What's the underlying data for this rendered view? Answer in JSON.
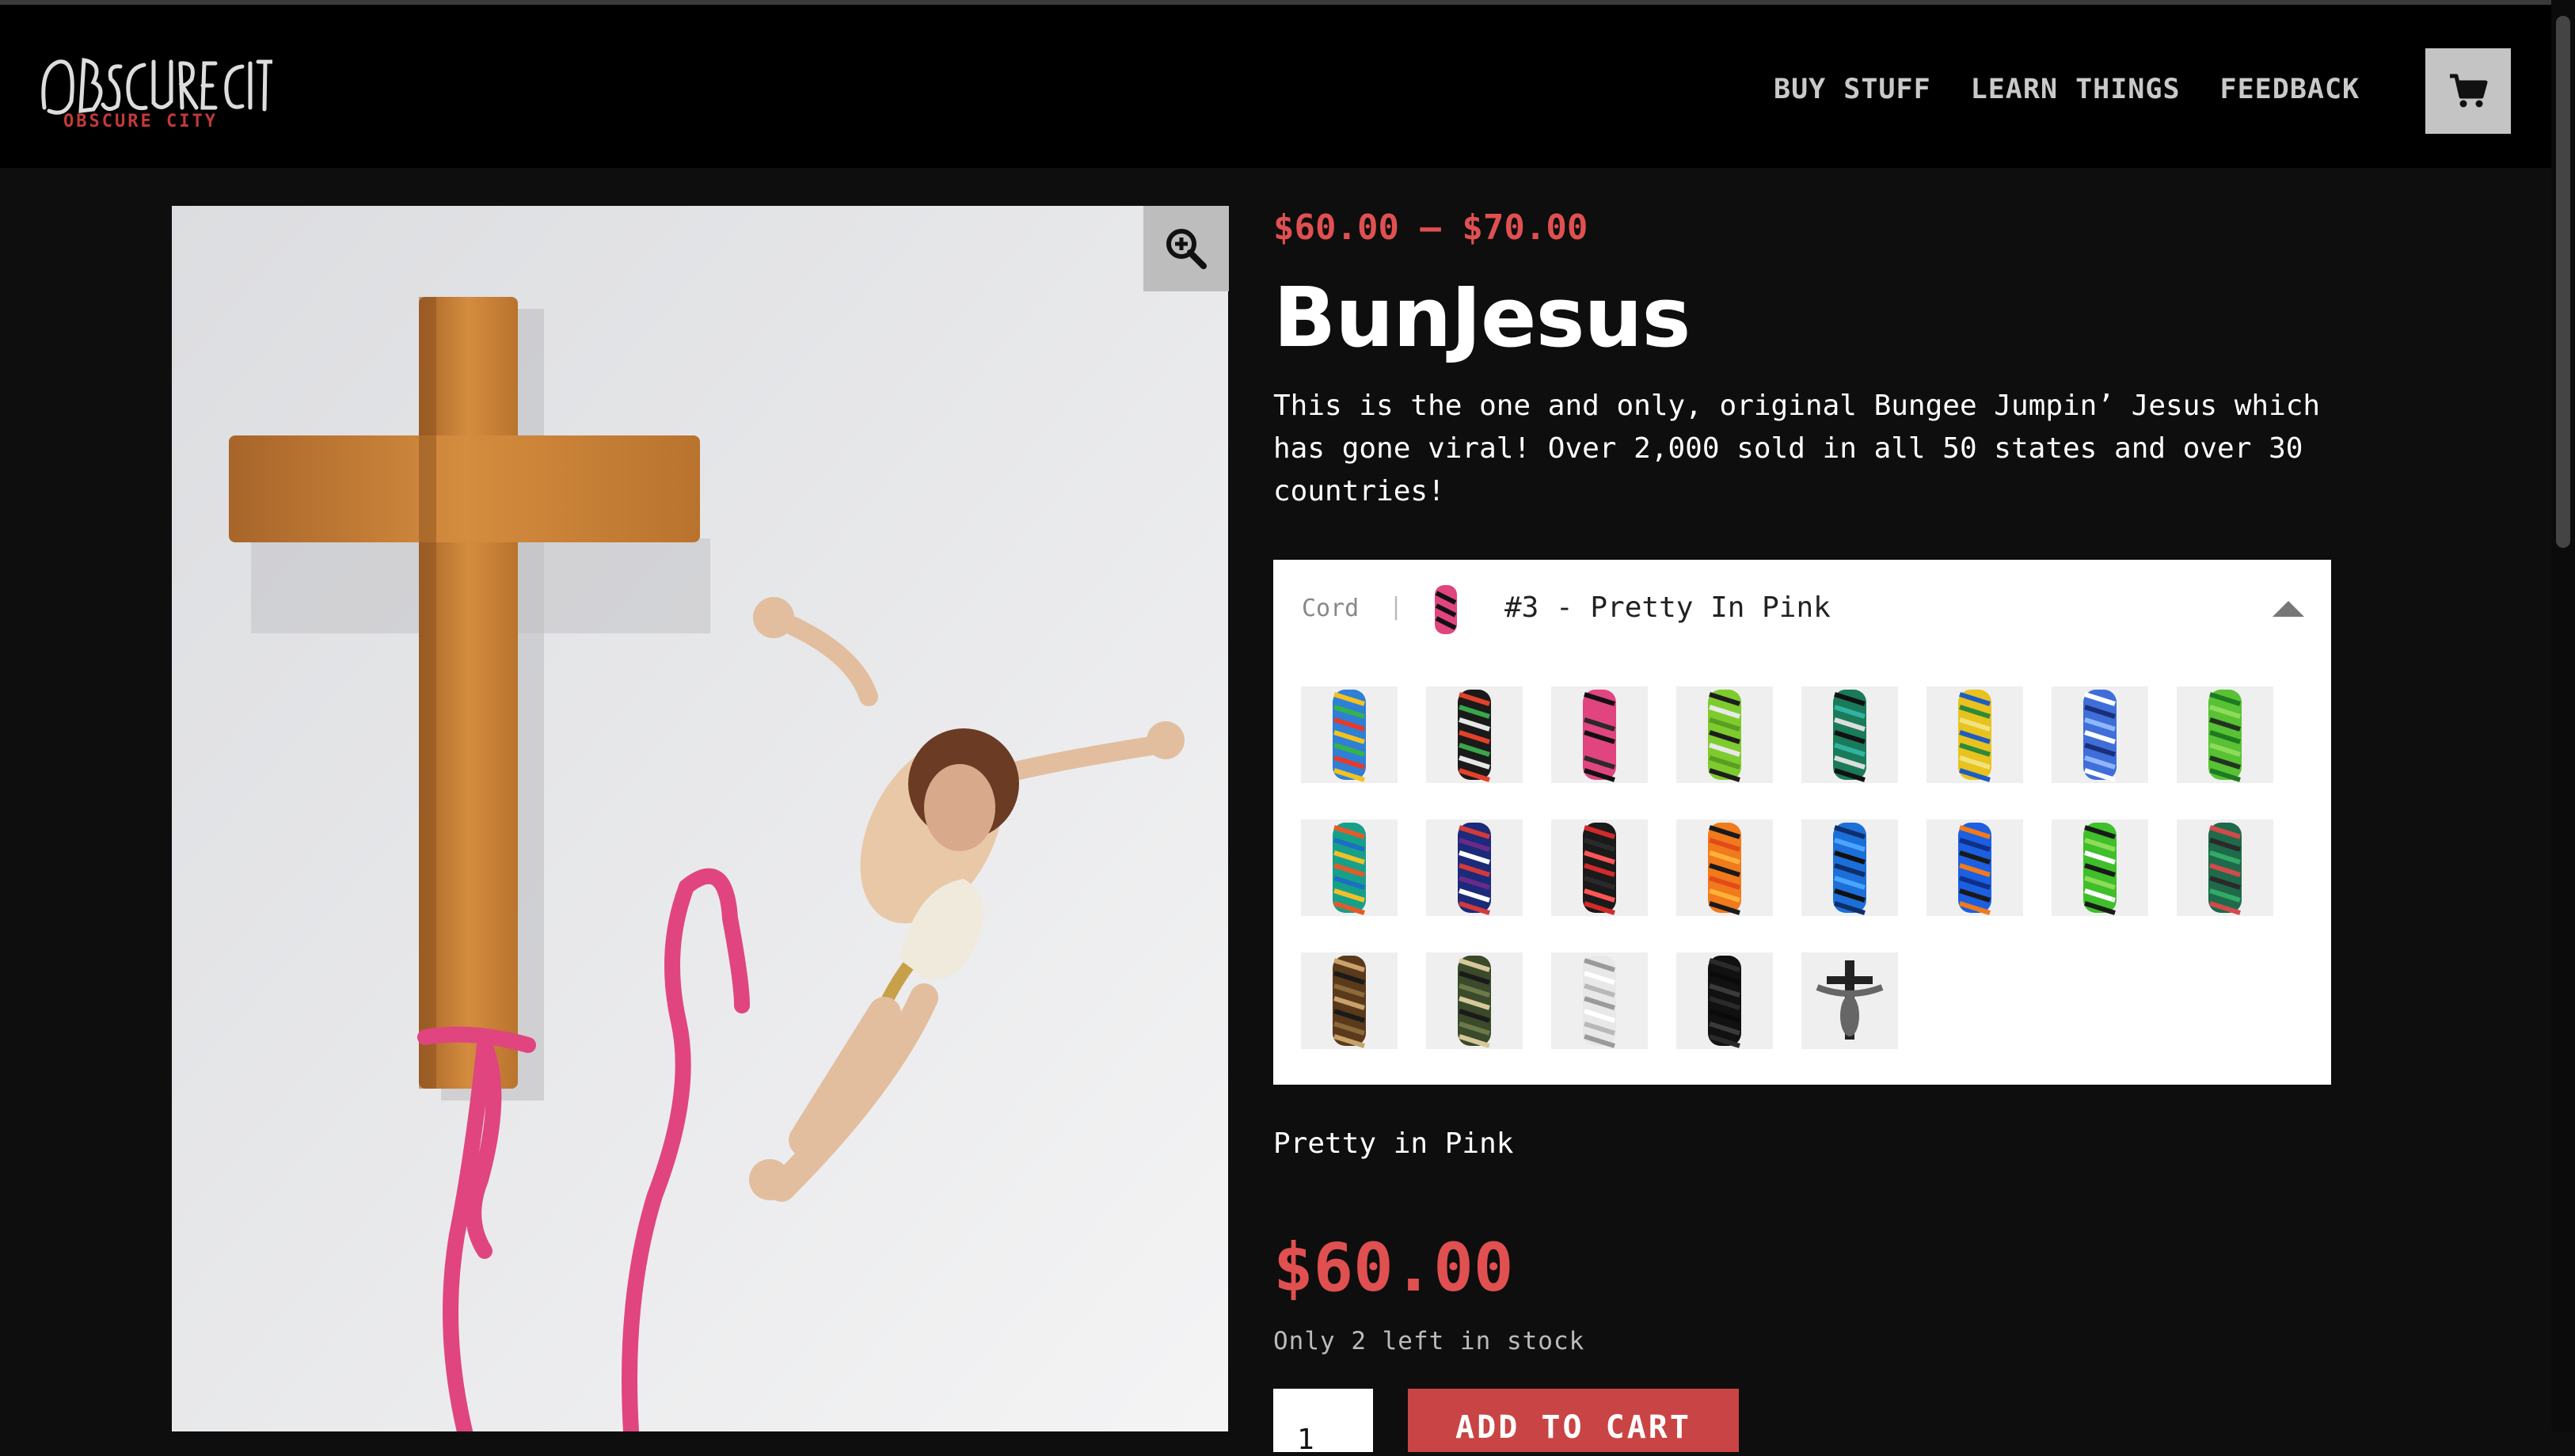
{
  "header": {
    "logo_text": "OBSCURE CITY",
    "nav": [
      {
        "label": "BUY STUFF"
      },
      {
        "label": "LEARN THINGS"
      },
      {
        "label": "FEEDBACK"
      }
    ]
  },
  "product": {
    "price_range": "$60.00 – $70.00",
    "title": "BunJesus",
    "description": "This is the one and only, original Bungee Jumpin’ Jesus which has gone viral! Over 2,000 sold in all 50 states and over 30 countries!",
    "variation": {
      "label": "Cord",
      "separator": "|",
      "selected": "#3 - Pretty In Pink",
      "swatches": [
        {
          "colors": [
            "#2f7fd6",
            "#f2c21e",
            "#34b34a",
            "#e63a2b"
          ]
        },
        {
          "colors": [
            "#1a1a1a",
            "#e3412b",
            "#3aa64a",
            "#e6e6e6"
          ]
        },
        {
          "colors": [
            "#e0457f",
            "#111111",
            "#e0457f",
            "#2a2a2a"
          ]
        },
        {
          "colors": [
            "#7ecb2e",
            "#1d1d1d",
            "#e8e8e8",
            "#5a9d22"
          ]
        },
        {
          "colors": [
            "#1a7a5a",
            "#111111",
            "#2fb3a0",
            "#dddddd"
          ]
        },
        {
          "colors": [
            "#e8c21e",
            "#1e5cc2",
            "#2c8a3a",
            "#f1e27a"
          ]
        },
        {
          "colors": [
            "#3f6ed8",
            "#ffffff",
            "#1a2f7a",
            "#8fb6ff"
          ]
        },
        {
          "colors": [
            "#58c234",
            "#1e7a22",
            "#8edb5a",
            "#223322"
          ]
        },
        {
          "colors": [
            "#16a08a",
            "#e35a2a",
            "#1c6fc2",
            "#f1c028"
          ]
        },
        {
          "colors": [
            "#1c2a7a",
            "#d33a3a",
            "#6a2a8a",
            "#ffffff"
          ]
        },
        {
          "colors": [
            "#1a1a1a",
            "#d22a2a",
            "#2a2a2a",
            "#ff5555"
          ]
        },
        {
          "colors": [
            "#f07a1c",
            "#1a1a1a",
            "#e34a1a",
            "#ffb23a"
          ]
        },
        {
          "colors": [
            "#1c6fd8",
            "#0e2f6a",
            "#49a6ff",
            "#111111"
          ]
        },
        {
          "colors": [
            "#1c5fe0",
            "#f07a1c",
            "#0e2f8a",
            "#1a1a1a"
          ]
        },
        {
          "colors": [
            "#3fbf2a",
            "#1a1a1a",
            "#8edb5a",
            "#ffffff"
          ]
        },
        {
          "colors": [
            "#1e6a4a",
            "#d24a4a",
            "#2a2a2a",
            "#33aa66"
          ]
        },
        {
          "colors": [
            "#5a3a1a",
            "#c8a26a",
            "#1a1a1a",
            "#8a6a3a"
          ]
        },
        {
          "colors": [
            "#3a4a2a",
            "#d6c89a",
            "#1a1a1a",
            "#6a7a4a"
          ]
        },
        {
          "colors": [
            "#e8e8e8",
            "#9a9a9a",
            "#ffffff",
            "#b8b8b8"
          ]
        },
        {
          "colors": [
            "#111111",
            "#2a2a2a",
            "#0a0a0a",
            "#3a3a3a"
          ]
        },
        {
          "colors": [
            "#222222",
            "#666666",
            "#111111",
            "#dddddd"
          ]
        }
      ]
    },
    "selected_name": "Pretty in Pink",
    "price": "$60.00",
    "stock": "Only 2 left in stock",
    "quantity": "1",
    "add_to_cart": "ADD TO CART"
  },
  "colors": {
    "accent_red": "#e05050",
    "button_red": "#c94444",
    "header_bg": "#000000",
    "page_bg": "#0e0e0e",
    "cord_pink": "#e0457f"
  },
  "icons": {
    "cart": "cart-icon",
    "zoom": "zoom-in-icon",
    "caret": "caret-up-icon"
  }
}
